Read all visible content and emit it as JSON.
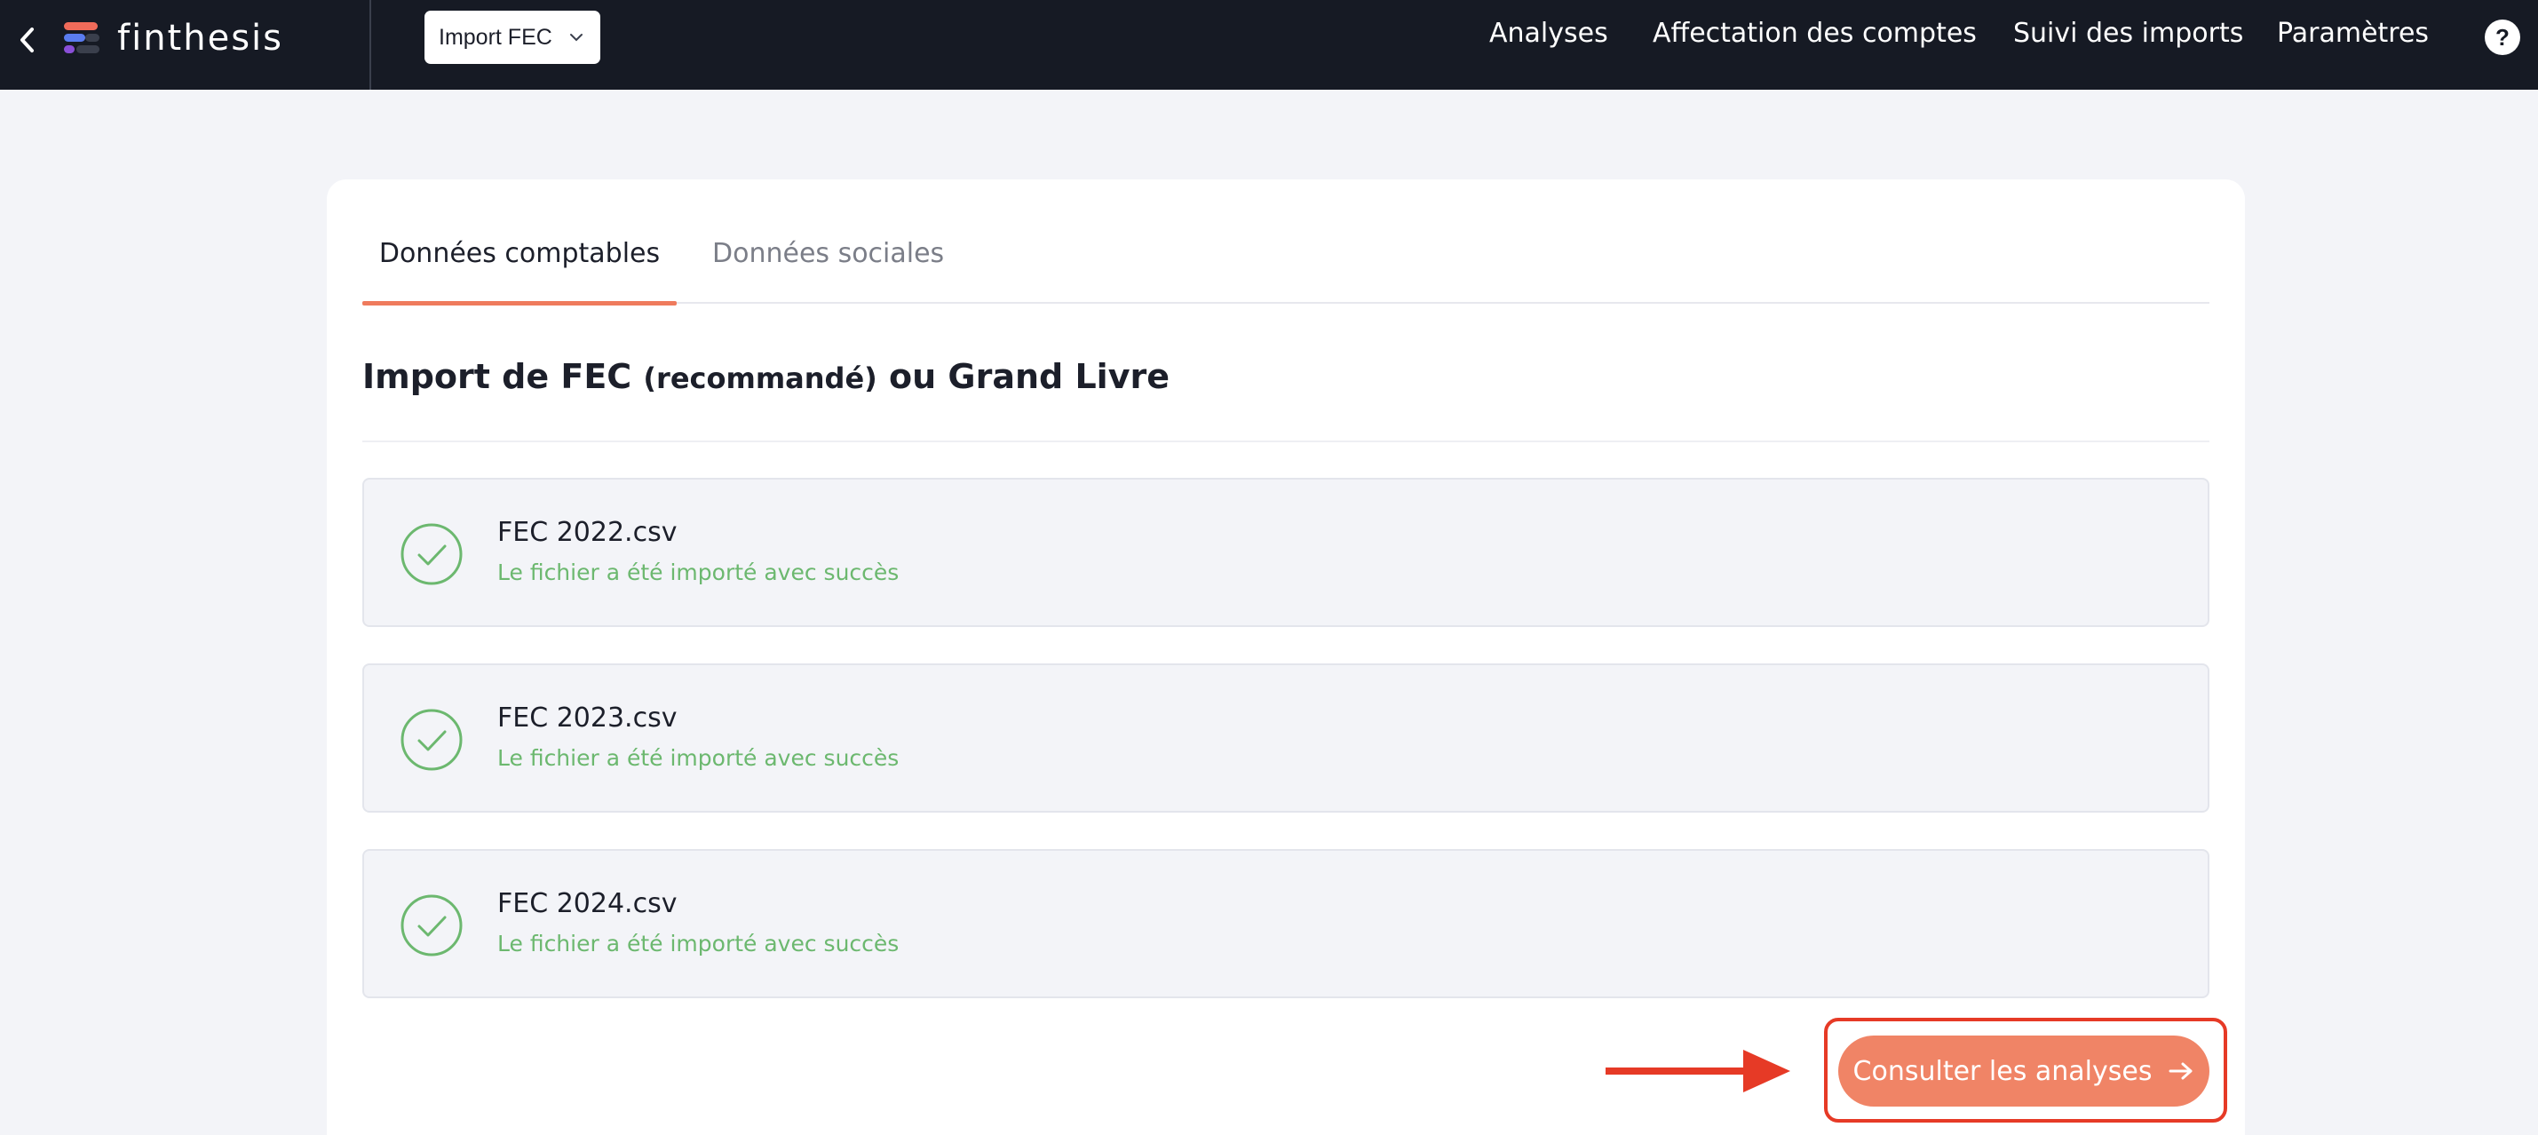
{
  "topbar": {
    "brand": "finthesis",
    "project_select": "Import FEC",
    "nav": [
      "Analyses",
      "Affectation des comptes",
      "Suivi des imports",
      "Paramètres"
    ],
    "help_label": "?"
  },
  "tabs": [
    {
      "label": "Données comptables",
      "active": true
    },
    {
      "label": "Données sociales",
      "active": false
    }
  ],
  "section": {
    "title_prefix": "Import de FEC ",
    "title_small": "(recommandé)",
    "title_suffix": " ou Grand Livre"
  },
  "files": [
    {
      "name": "FEC 2022.csv",
      "status": "Le fichier a été importé avec succès"
    },
    {
      "name": "FEC 2023.csv",
      "status": "Le fichier a été importé avec succès"
    },
    {
      "name": "FEC 2024.csv",
      "status": "Le fichier a été importé avec succès"
    }
  ],
  "cta": {
    "label": "Consulter les analyses"
  },
  "colors": {
    "topbar": "#161a24",
    "accent": "#ef7b5d",
    "success": "#6cb86f",
    "highlight": "#e63a26"
  },
  "icons": {
    "back": "chevron-left-icon",
    "select": "chevron-down-icon",
    "help": "help-icon",
    "file_status": "check-circle-icon",
    "cta": "arrow-right-icon",
    "annotation": "pointer-arrow-icon"
  }
}
